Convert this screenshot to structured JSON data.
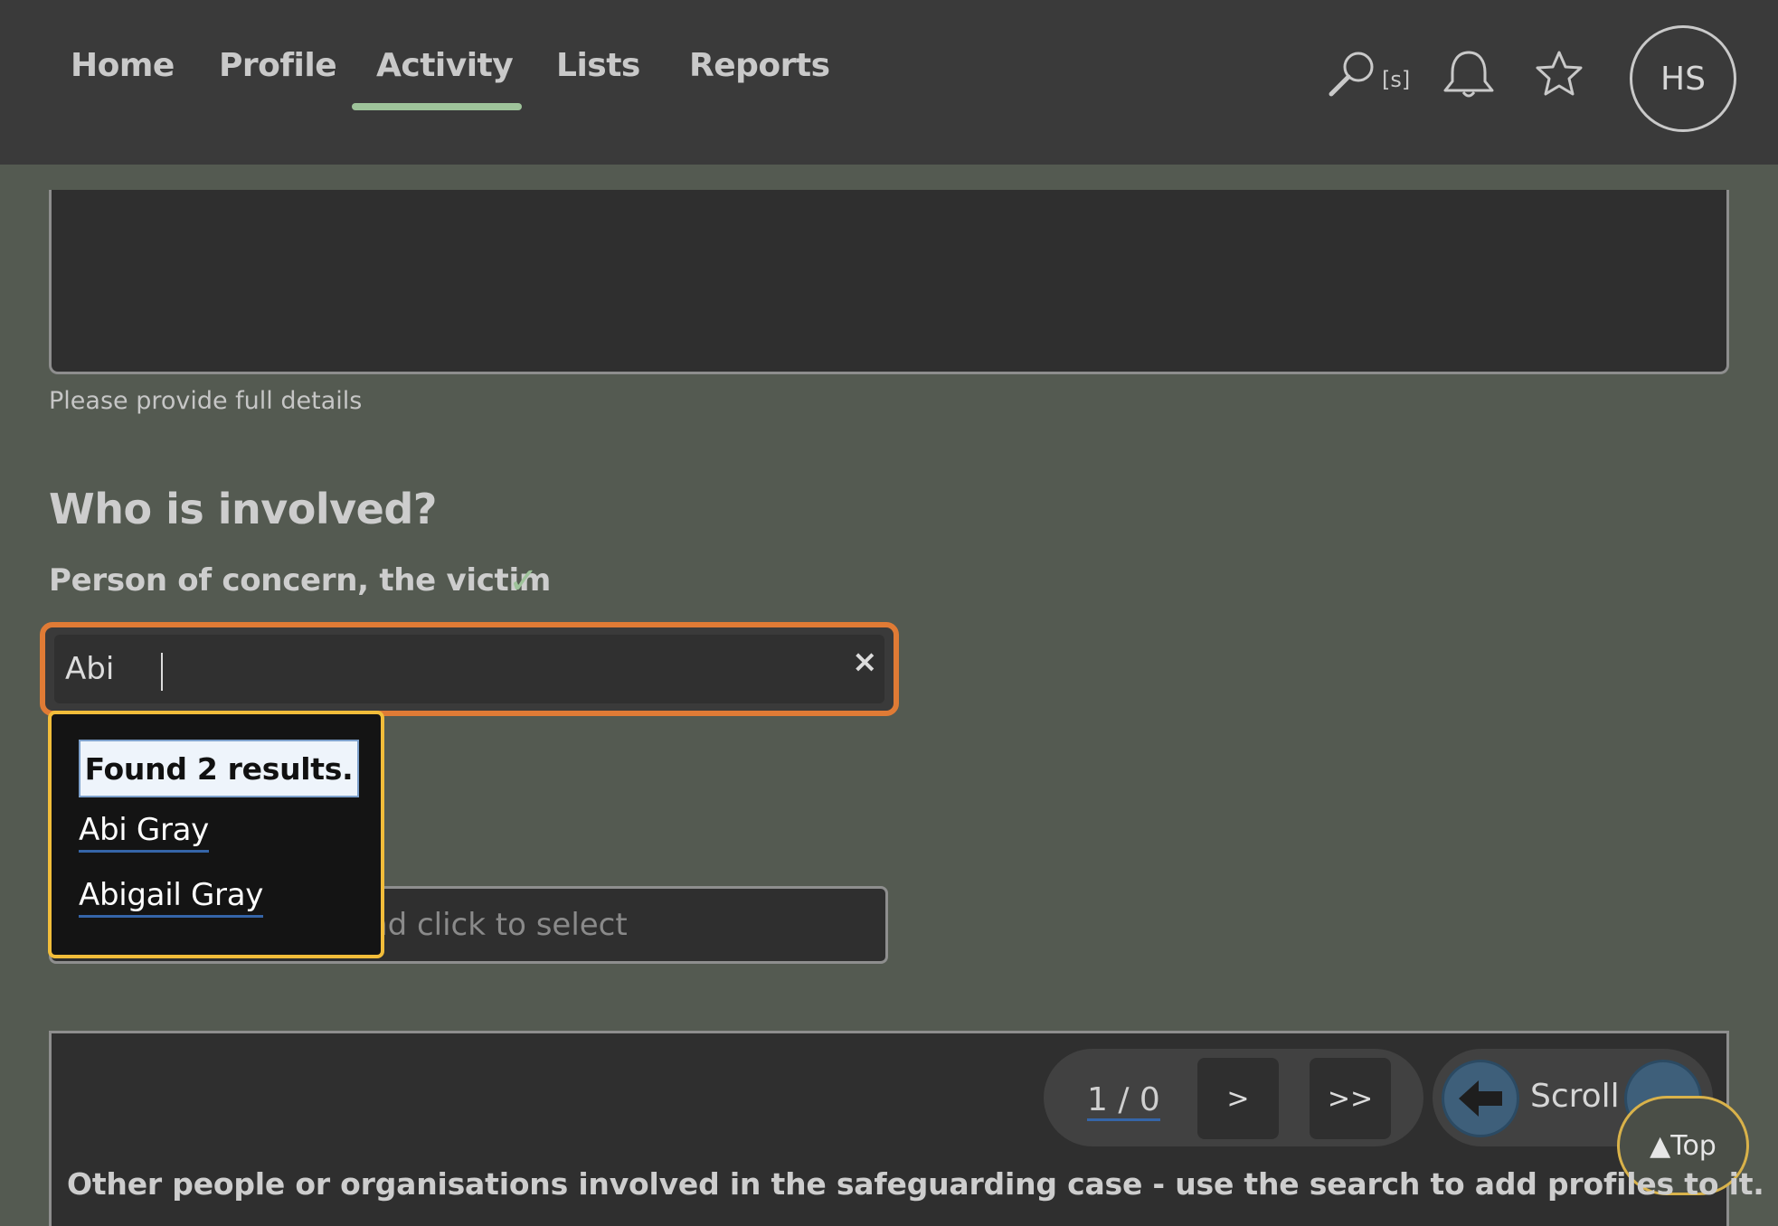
{
  "nav": {
    "links": [
      "Home",
      "Profile",
      "Activity",
      "Lists",
      "Reports"
    ],
    "active": "Activity",
    "search_shortcut": "[s]",
    "avatar_initials": "HS",
    "icons": [
      "search-icon",
      "bell-icon",
      "star-icon"
    ]
  },
  "form": {
    "details_hint": "Please provide full details",
    "section_title": "Who is involved?",
    "victim_label": "Person of concern, the victim",
    "victim_check": "✓",
    "search_value": "Abi",
    "clear_symbol": "×",
    "second_placeholder": "Type a name here and click to select"
  },
  "dropdown": {
    "status": "Found 2 results.",
    "results": [
      "Abi Gray",
      "Abigail Gray"
    ]
  },
  "bottom": {
    "page_indicator": "1 / 0",
    "next_label": ">",
    "last_label": ">>",
    "scroll_label": "Scroll",
    "top_label": "▲Top",
    "description": "Other people or organisations involved in the safeguarding case - use the search to add profiles to it."
  },
  "colors": {
    "accent_green": "#9ec39a",
    "focus_orange": "#e07b35",
    "dropdown_border": "#f2bd3a",
    "link_underline": "#3565a8"
  }
}
